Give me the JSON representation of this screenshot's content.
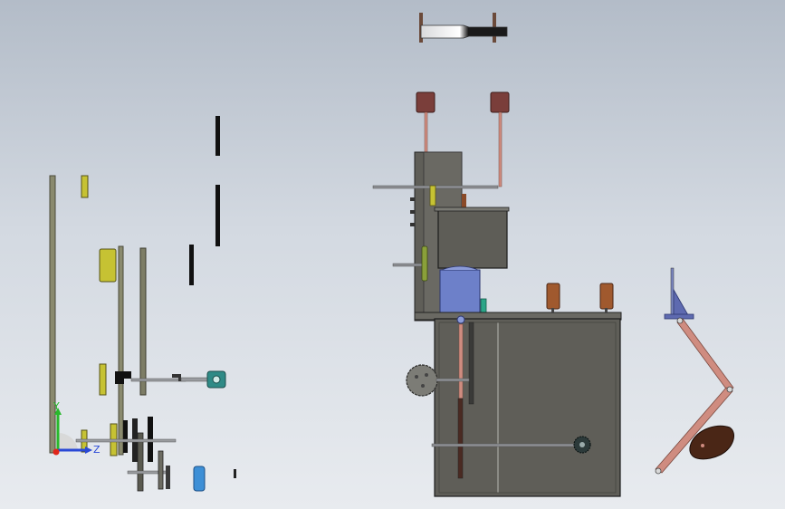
{
  "window": {
    "title": ""
  },
  "triad": {
    "y_label": "Y",
    "z_label": "Z",
    "colors": {
      "x": "#e0261a",
      "y": "#29b92c",
      "z": "#2a49d6"
    }
  },
  "palette": {
    "frame_gray": "#5f5e58",
    "rail_olive": "#8a8a6e",
    "yellow_part": "#c6c233",
    "copper_rod": "#cf8c80",
    "brown_pad": "#a0592e",
    "blue_motor": "#6d80c9",
    "teal_gear": "#2f8a86",
    "shaft_gray": "#8d8f93",
    "dark_brown": "#4a2616"
  }
}
